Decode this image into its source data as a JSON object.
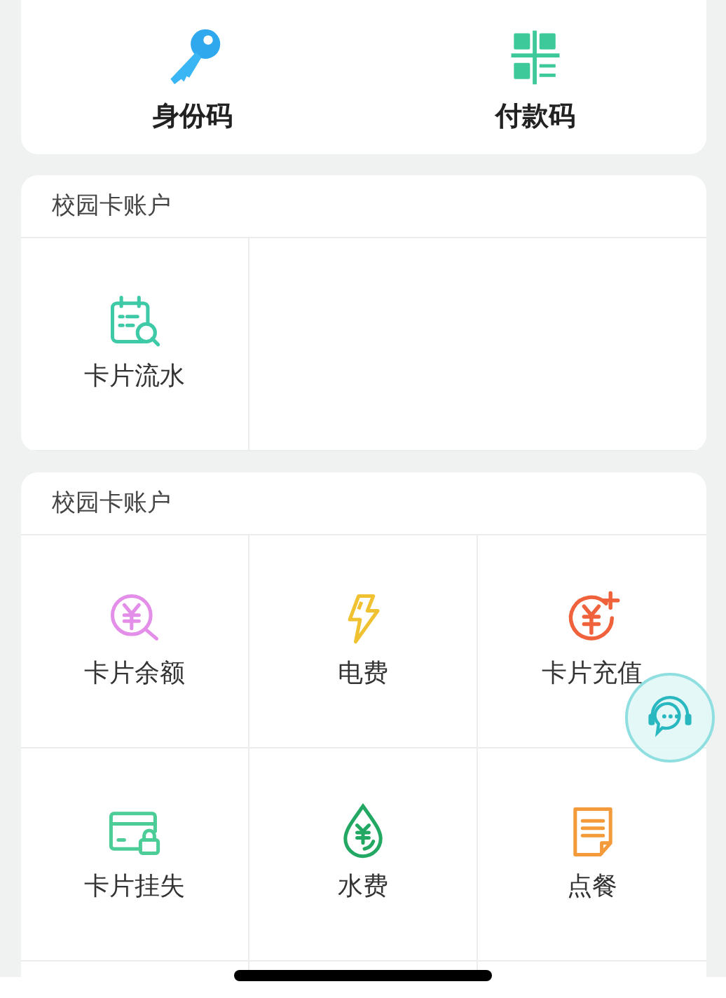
{
  "quick_actions": [
    {
      "label": "身份码"
    },
    {
      "label": "付款码"
    }
  ],
  "sections": [
    {
      "title": "校园卡账户",
      "items": [
        {
          "label": "卡片流水"
        }
      ]
    },
    {
      "title": "校园卡账户",
      "items": [
        {
          "label": "卡片余额"
        },
        {
          "label": "电费"
        },
        {
          "label": "卡片充值"
        },
        {
          "label": "卡片挂失"
        },
        {
          "label": "水费"
        },
        {
          "label": "点餐"
        }
      ]
    }
  ]
}
